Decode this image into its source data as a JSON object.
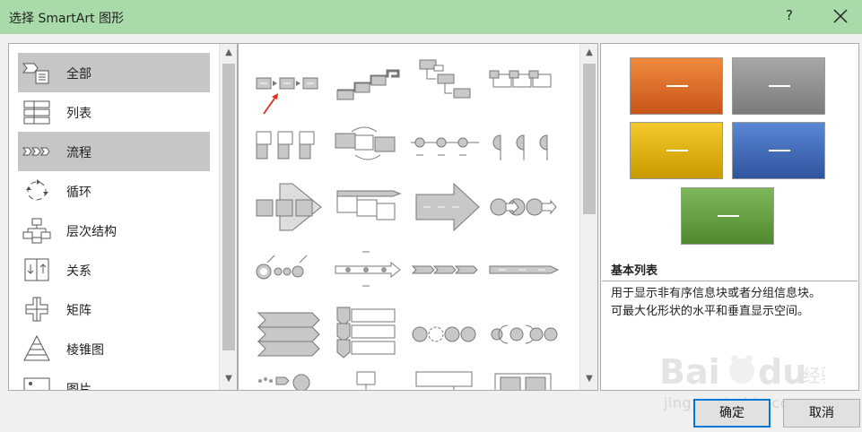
{
  "window": {
    "title": "选择 SmartArt 图形",
    "help_label": "?"
  },
  "categories": [
    {
      "label": "全部",
      "icon": "all-icon",
      "selected": true
    },
    {
      "label": "列表",
      "icon": "list-icon",
      "selected": false
    },
    {
      "label": "流程",
      "icon": "process-icon",
      "selected": true
    },
    {
      "label": "循环",
      "icon": "cycle-icon",
      "selected": false
    },
    {
      "label": "层次结构",
      "icon": "hierarchy-icon",
      "selected": false
    },
    {
      "label": "关系",
      "icon": "relationship-icon",
      "selected": false
    },
    {
      "label": "矩阵",
      "icon": "matrix-icon",
      "selected": false
    },
    {
      "label": "棱锥图",
      "icon": "pyramid-icon",
      "selected": false
    },
    {
      "label": "图片",
      "icon": "picture-icon",
      "selected": false
    }
  ],
  "preview": {
    "layout_name": "基本列表",
    "description_line1": "用于显示非有序信息块或者分组信息块。",
    "description_line2": "可最大化形状的水平和垂直显示空间。",
    "colors": [
      "#e06a1e",
      "#8c8c8c",
      "#e8b400",
      "#3d66b3",
      "#5f9a3a"
    ]
  },
  "buttons": {
    "ok": "确定",
    "cancel": "取消"
  },
  "watermark": {
    "logo": "Bai du 经验",
    "url": "jingyan.baidu.com"
  }
}
